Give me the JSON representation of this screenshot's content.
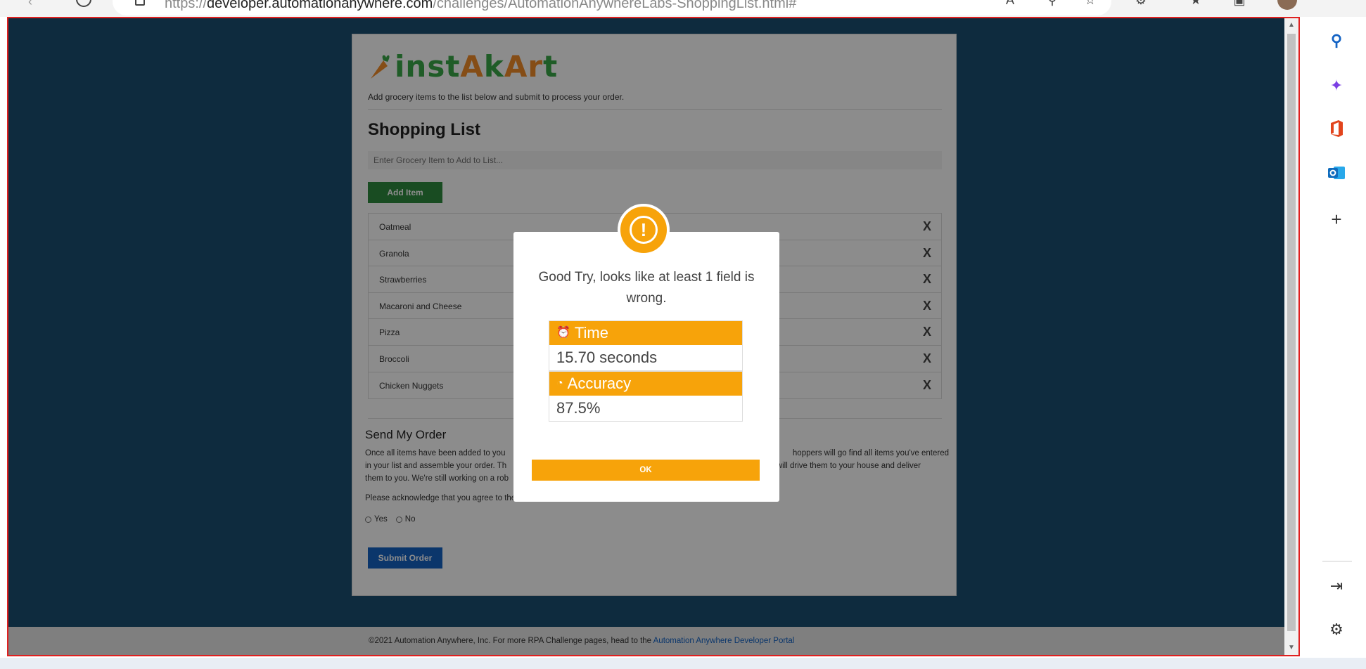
{
  "browser": {
    "url_host": "developer.automationanywhere.com",
    "url_scheme": "https://",
    "url_path": "/challenges/AutomationAnywhereLabs-ShoppingList.html#"
  },
  "app": {
    "logo_brand": "instAkArt",
    "subtitle": "Add grocery items to the list below and submit to process your order.",
    "title": "Shopping List",
    "input_placeholder": "Enter Grocery Item to Add to List...",
    "add_button": "Add Item",
    "items": [
      {
        "name": "Oatmeal",
        "remove": "X"
      },
      {
        "name": "Granola",
        "remove": "X"
      },
      {
        "name": "Strawberries",
        "remove": "X"
      },
      {
        "name": "Macaroni and Cheese",
        "remove": "X"
      },
      {
        "name": "Pizza",
        "remove": "X"
      },
      {
        "name": "Broccoli",
        "remove": "X"
      },
      {
        "name": "Chicken Nuggets",
        "remove": "X"
      }
    ],
    "order_title": "Send My Order",
    "order_text_1": "Once all items have been added to you",
    "order_text_1b": "hoppers will go find all items you've entered",
    "order_text_2": "in your list and assemble your order. Th",
    "order_text_2b": "will drive them to your house and deliver",
    "order_text_3": "them to you. We're still working on a rob",
    "ack_text": "Please acknowledge that you agree to the terms above.",
    "radio_yes": "Yes",
    "radio_no": "No",
    "submit_button": "Submit Order",
    "footer_text": "©2021 Automation Anywhere, Inc. For more RPA Challenge pages, head to the ",
    "footer_link": "Automation Anywhere Developer Portal"
  },
  "modal": {
    "message": "Good Try, looks like at least 1 field is wrong.",
    "time_label": "Time",
    "time_value": "15.70 seconds",
    "accuracy_label": "Accuracy",
    "accuracy_value": "87.5%",
    "ok_button": "OK"
  },
  "sidepanel": {
    "icons": [
      "search-icon",
      "copilot-icon",
      "office-icon",
      "outlook-icon",
      "add-icon",
      "split-screen-icon",
      "settings-icon"
    ]
  },
  "colors": {
    "page_bg": "#1b4f72",
    "accent_orange": "#f7a30a",
    "add_green": "#2e8b3e",
    "submit_blue": "#1463c4"
  }
}
